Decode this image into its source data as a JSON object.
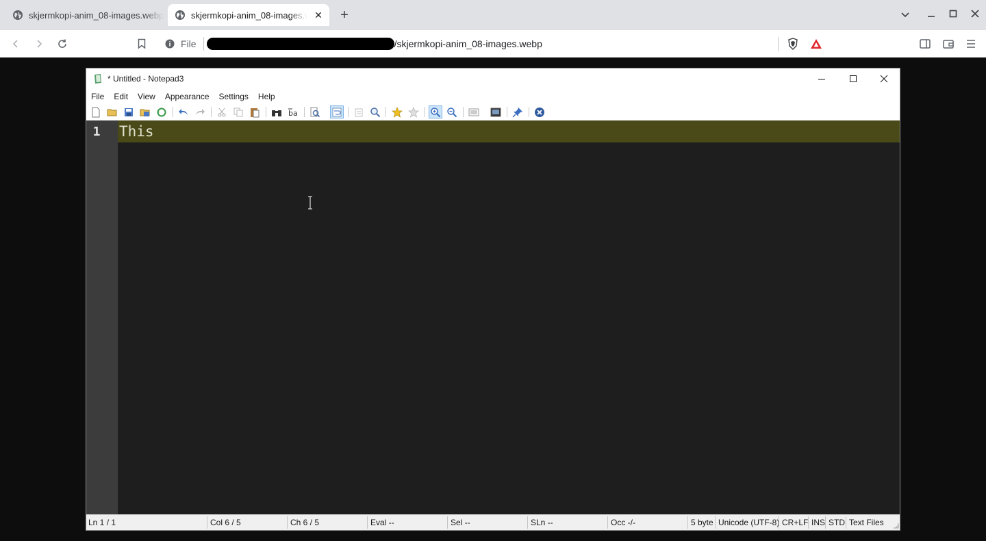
{
  "browser": {
    "tabs": [
      {
        "title": "skjermkopi-anim_08-images.webp",
        "active": false
      },
      {
        "title": "skjermkopi-anim_08-images.webp",
        "active": true
      }
    ],
    "tab_close_glyph": "✕",
    "new_tab_glyph": "+",
    "omnibox": {
      "scheme_label": "File",
      "url_visible": "/skjermkopi-anim_08-images.webp"
    }
  },
  "notepad": {
    "title": "* Untitled - Notepad3",
    "menu": [
      "File",
      "Edit",
      "View",
      "Appearance",
      "Settings",
      "Help"
    ],
    "editor": {
      "line_number": "1",
      "line_text": "This"
    },
    "status": {
      "ln": "Ln  1 / 1",
      "col": "Col  6 / 5",
      "ch": "Ch  6 / 5",
      "eval": "Eval  --",
      "sel": "Sel  --",
      "sln": "SLn  --",
      "occ": "Occ  -/-",
      "size": "5 byte",
      "encoding": "Unicode (UTF-8)",
      "eol": "CR+LF",
      "ins": "INS",
      "std": "STD",
      "filetype": "Text Files"
    }
  },
  "colors": {
    "editor_bg": "#1e1e1e",
    "current_line": "#4a4a18",
    "gutter": "#3c3c3c",
    "brave_accent": "#ff5000"
  }
}
